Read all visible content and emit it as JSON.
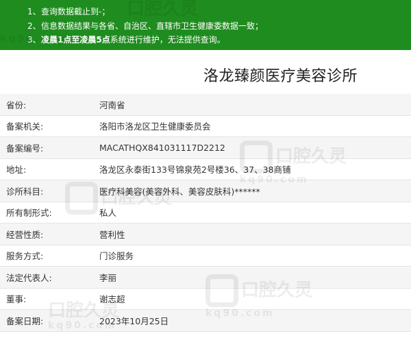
{
  "notice": {
    "line1": {
      "num": "1、",
      "text": "查询数据截止到-；"
    },
    "line2": {
      "num": "2、",
      "text": "信息数据结果与各省、自治区、直辖市卫生健康委数据一致；"
    },
    "line3": {
      "num": "3、",
      "bold1": "凌晨1点至凌晨5点",
      "text": "系统进行维护，无法提供查询。"
    }
  },
  "title": "洛龙臻颜医疗美容诊所",
  "rows": [
    {
      "label": "省份:",
      "value": "河南省"
    },
    {
      "label": "备案机关:",
      "value": "洛阳市洛龙区卫生健康委员会"
    },
    {
      "label": "备案编号:",
      "value": "MACATHQX841031117D2212"
    },
    {
      "label": "地址:",
      "value": "洛龙区永泰街133号锦泉苑2号楼36、37、38商铺"
    },
    {
      "label": "诊所科目:",
      "value": "医疗科美容(美容外科、美容皮肤科)******"
    },
    {
      "label": "所有制形式:",
      "value": "私人"
    },
    {
      "label": "经营性质:",
      "value": "营利性"
    },
    {
      "label": "服务方式:",
      "value": "门诊服务"
    },
    {
      "label": "法定代表人:",
      "value": "李丽"
    },
    {
      "label": "董事:",
      "value": "谢志超"
    },
    {
      "label": "备案日期:",
      "value": "2023年10月25日"
    }
  ],
  "watermark": {
    "brand": "口腔久灵",
    "domain": "kq90.com"
  },
  "colors": {
    "banner": "#1f8c1f",
    "row_alt": "#f5f5f5"
  }
}
